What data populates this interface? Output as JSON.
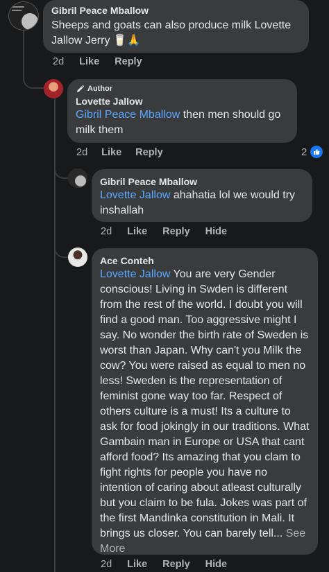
{
  "comments": [
    {
      "author": "Gibril Peace Mballow",
      "text": "Sheeps and goats can also produce milk Lovette Jallow Jerry 🥛🙏",
      "time": "2d",
      "actions": [
        "Like",
        "Reply"
      ]
    },
    {
      "badge": "Author",
      "author": "Lovette Jallow",
      "tag": "Gibril Peace Mballow",
      "text": " then men should go milk them",
      "time": "2d",
      "actions": [
        "Like",
        "Reply"
      ],
      "reaction_count": "2",
      "reaction_icon": "like-icon"
    },
    {
      "author": "Gibril Peace Mballow",
      "tag": "Lovette Jallow",
      "text": " ahahatia lol we would try inshallah",
      "time": "2d",
      "actions": [
        "Like",
        "Reply",
        "Hide"
      ]
    },
    {
      "author": "Ace Conteh",
      "tag": "Lovette Jallow",
      "text": " You are very Gender conscious! Living in Swden is different from the rest of the world. I doubt you will find a good man. Too aggressive might I say. No wonder the birth rate of Sweden is worst than Japan. Why can't you Milk the cow? You were raised as equal to men no less! Sweden is the representation of feminist gone way too far. Respect of others culture is a must! Its a culture to ask for food jokingly in our traditions. What Gambain man in Europe or USA that cant afford food? Its amazing that you clam to fight rights for people you have no intention of caring about atleast culturally but you claim to be fula. Jokes was part of the first Mandinka constitution in Mali. It brings us closer.  You can barely tell...",
      "see_more": " See More",
      "time": "2d",
      "actions": [
        "Like",
        "Reply",
        "Hide"
      ]
    }
  ],
  "colors": {
    "background": "#18191a",
    "bubble": "#3a3b3c",
    "tag": "#5aa7ff",
    "like_blue": "#1877f2"
  }
}
